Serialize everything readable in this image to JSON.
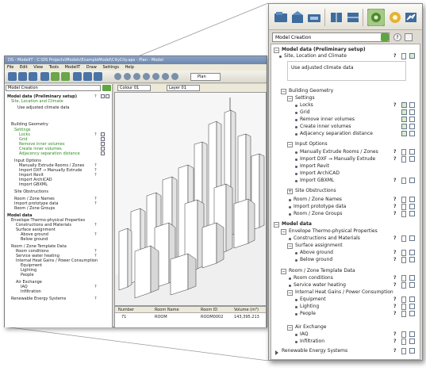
{
  "main_window": {
    "title": "DS - ModelIT : C:\\DS Projects\\Models\\ExampleModel\\CityCity.aps - Plan - Model",
    "menu": [
      "File",
      "Edit",
      "View",
      "Tools",
      "ModelIT",
      "Draw",
      "Settings",
      "Help"
    ],
    "view_mode": "Plan",
    "colour_select": "Colour 01",
    "layer_select": "Layer 01",
    "model_select": "Model Creation",
    "table": {
      "headers": [
        "Number",
        "Room Name",
        "Room ID",
        "Volume (m³)"
      ],
      "row": [
        "71",
        "ROOM",
        "ROOM0002",
        "143,395.213"
      ]
    }
  },
  "panel": {
    "dropdown": "Model Creation",
    "sections": [
      {
        "title": "Model data (Preliminary setup)",
        "bold": true
      },
      {
        "title": "Site, Location and Climate",
        "green": true
      },
      {
        "title": "Use adjusted climate data"
      },
      {
        "title": "Building Geometry"
      },
      {
        "title": "Settings",
        "green": true
      },
      {
        "title": "Locks",
        "green": true
      },
      {
        "title": "Grid",
        "green": true
      },
      {
        "title": "Remove inner volumes",
        "green": true
      },
      {
        "title": "Create inner volumes",
        "green": true
      },
      {
        "title": "Adjacency separation distance",
        "green": true
      },
      {
        "title": "Input Options"
      },
      {
        "title": "Manually Extrude Rooms / Zones"
      },
      {
        "title": "Import DXF → Manually Extrude"
      },
      {
        "title": "Import Revit"
      },
      {
        "title": "Import ArchiCAD"
      },
      {
        "title": "Import GBXML"
      },
      {
        "title": "Site Obstructions"
      },
      {
        "title": "Room / Zone Names"
      },
      {
        "title": "Import prototype data"
      },
      {
        "title": "Room / Zone Groups"
      },
      {
        "title": "Model data",
        "bold": true
      },
      {
        "title": "Envelope Thermo-physical Properties"
      },
      {
        "title": "Constructions and Materials"
      },
      {
        "title": "Surface assignment"
      },
      {
        "title": "Above ground"
      },
      {
        "title": "Below ground"
      },
      {
        "title": "Room / Zone Template Data"
      },
      {
        "title": "Room conditions"
      },
      {
        "title": "Service water heating"
      },
      {
        "title": "Internal Heat Gains / Power Consumption"
      },
      {
        "title": "Equipment"
      },
      {
        "title": "Lighting"
      },
      {
        "title": "People"
      },
      {
        "title": "Air Exchange"
      },
      {
        "title": "IAQ"
      },
      {
        "title": "Infiltration"
      },
      {
        "title": "Renewable Energy Systems"
      }
    ]
  },
  "colors": {
    "green": "#2e8b22",
    "accent": "#4a73a8",
    "panel_bg": "#dedad2"
  }
}
